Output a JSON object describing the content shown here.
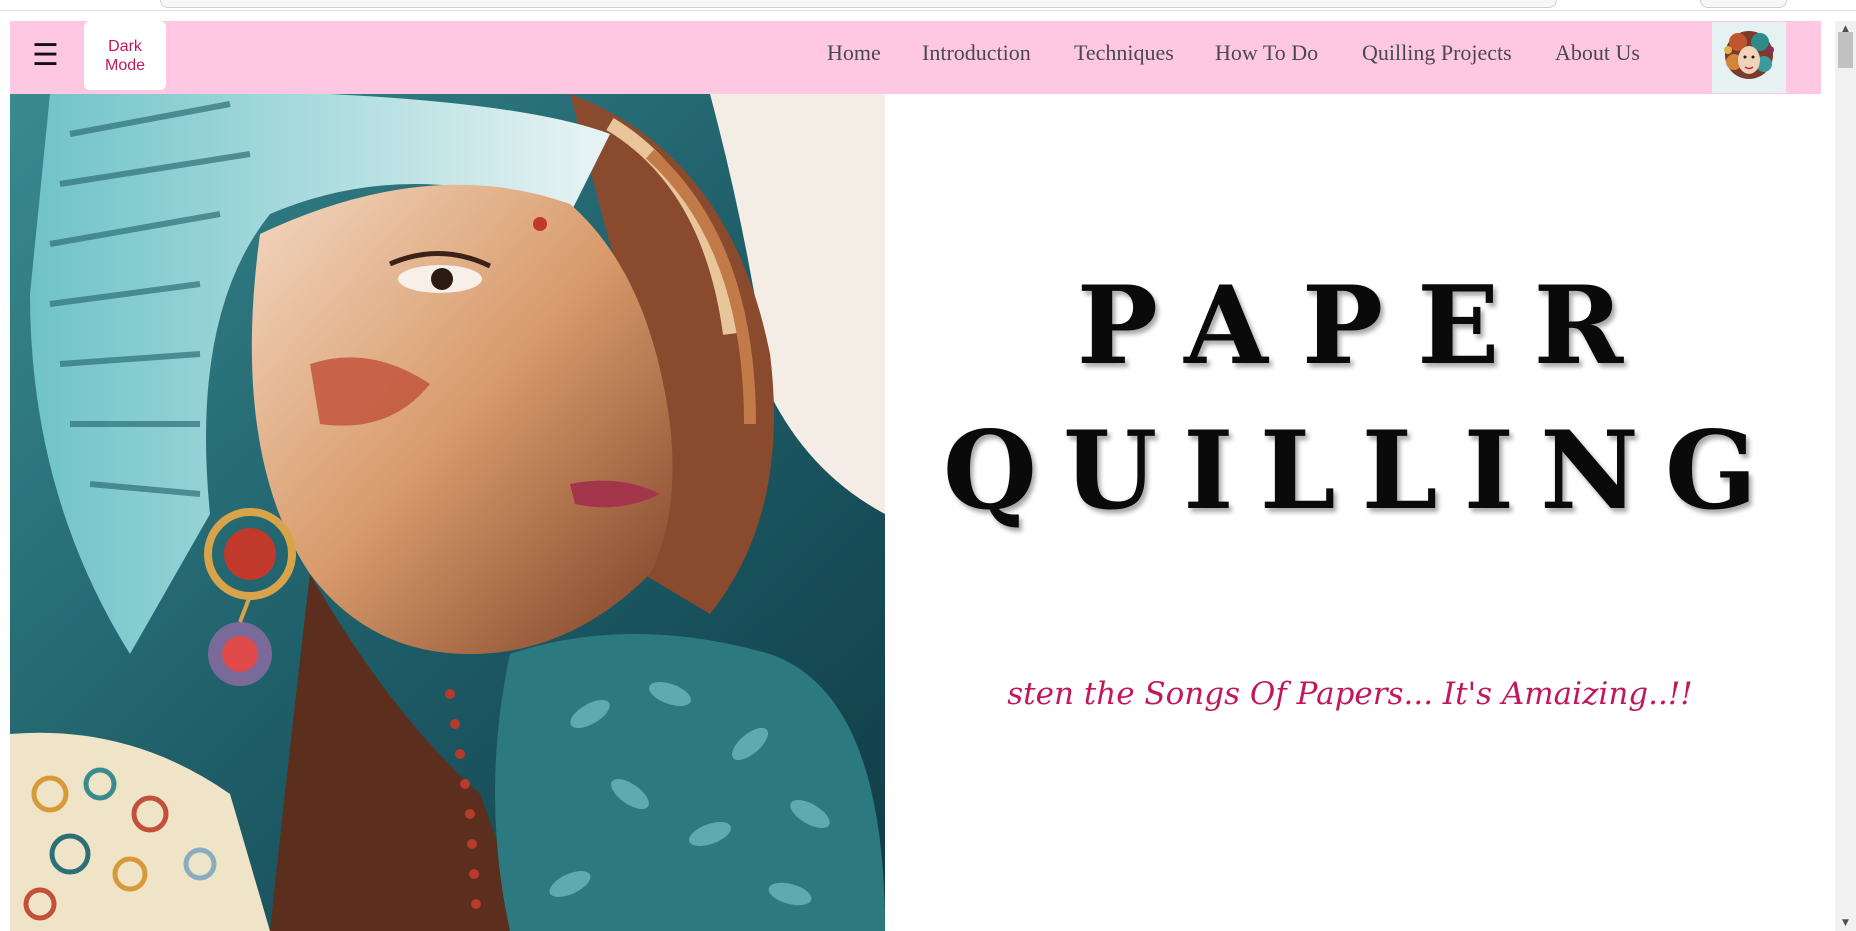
{
  "navbar": {
    "menu_icon": "hamburger-menu-icon",
    "menu_glyph": "☰",
    "dark_mode_label": "Dark Mode",
    "links": [
      "Home",
      "Introduction",
      "Techniques",
      "How To Do",
      "Quilling Projects",
      "About Us"
    ],
    "logo_icon": "quilled-portrait-logo",
    "background_color": "#ffc8e2"
  },
  "hero": {
    "title_line1": "PAPER",
    "title_line2": "QUILLING",
    "tagline": "sten the Songs Of Papers... It's Amaizing..!!",
    "tagline_color": "#c2185b",
    "image": "quilled-paper-portrait-of-woman"
  },
  "scrollbar": {
    "up_glyph": "▲",
    "down_glyph": "▼"
  }
}
